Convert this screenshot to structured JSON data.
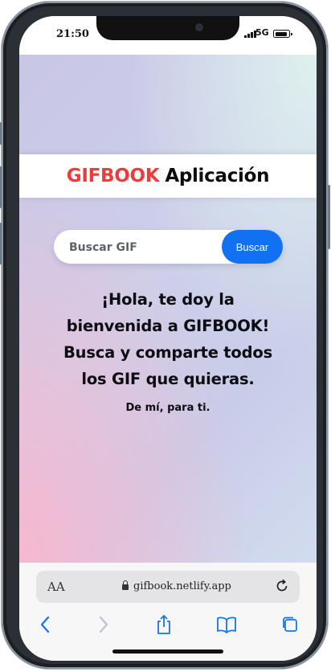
{
  "status_bar": {
    "time": "21:50",
    "network": "5G"
  },
  "header": {
    "brand": "GIFBOOK",
    "title_rest": "Aplicación"
  },
  "search": {
    "placeholder": "Buscar GIF",
    "value": "",
    "button_label": "Buscar"
  },
  "welcome": {
    "lines": [
      "¡Hola, te doy la",
      "bienvenida a GIFBOOK!",
      "Busca y comparte todos",
      "los GIF que quieras."
    ],
    "subtitle": "De mí, para ti."
  },
  "browser": {
    "aa_label": "AA",
    "url": "gifbook.netlify.app",
    "icons": [
      "back-icon",
      "forward-icon",
      "share-icon",
      "bookmarks-icon",
      "tabs-icon",
      "reload-icon",
      "lock-icon"
    ],
    "accent_color": "#1a73e8"
  },
  "colors": {
    "brand": "#ef3b3b",
    "button": "#1271f2"
  }
}
